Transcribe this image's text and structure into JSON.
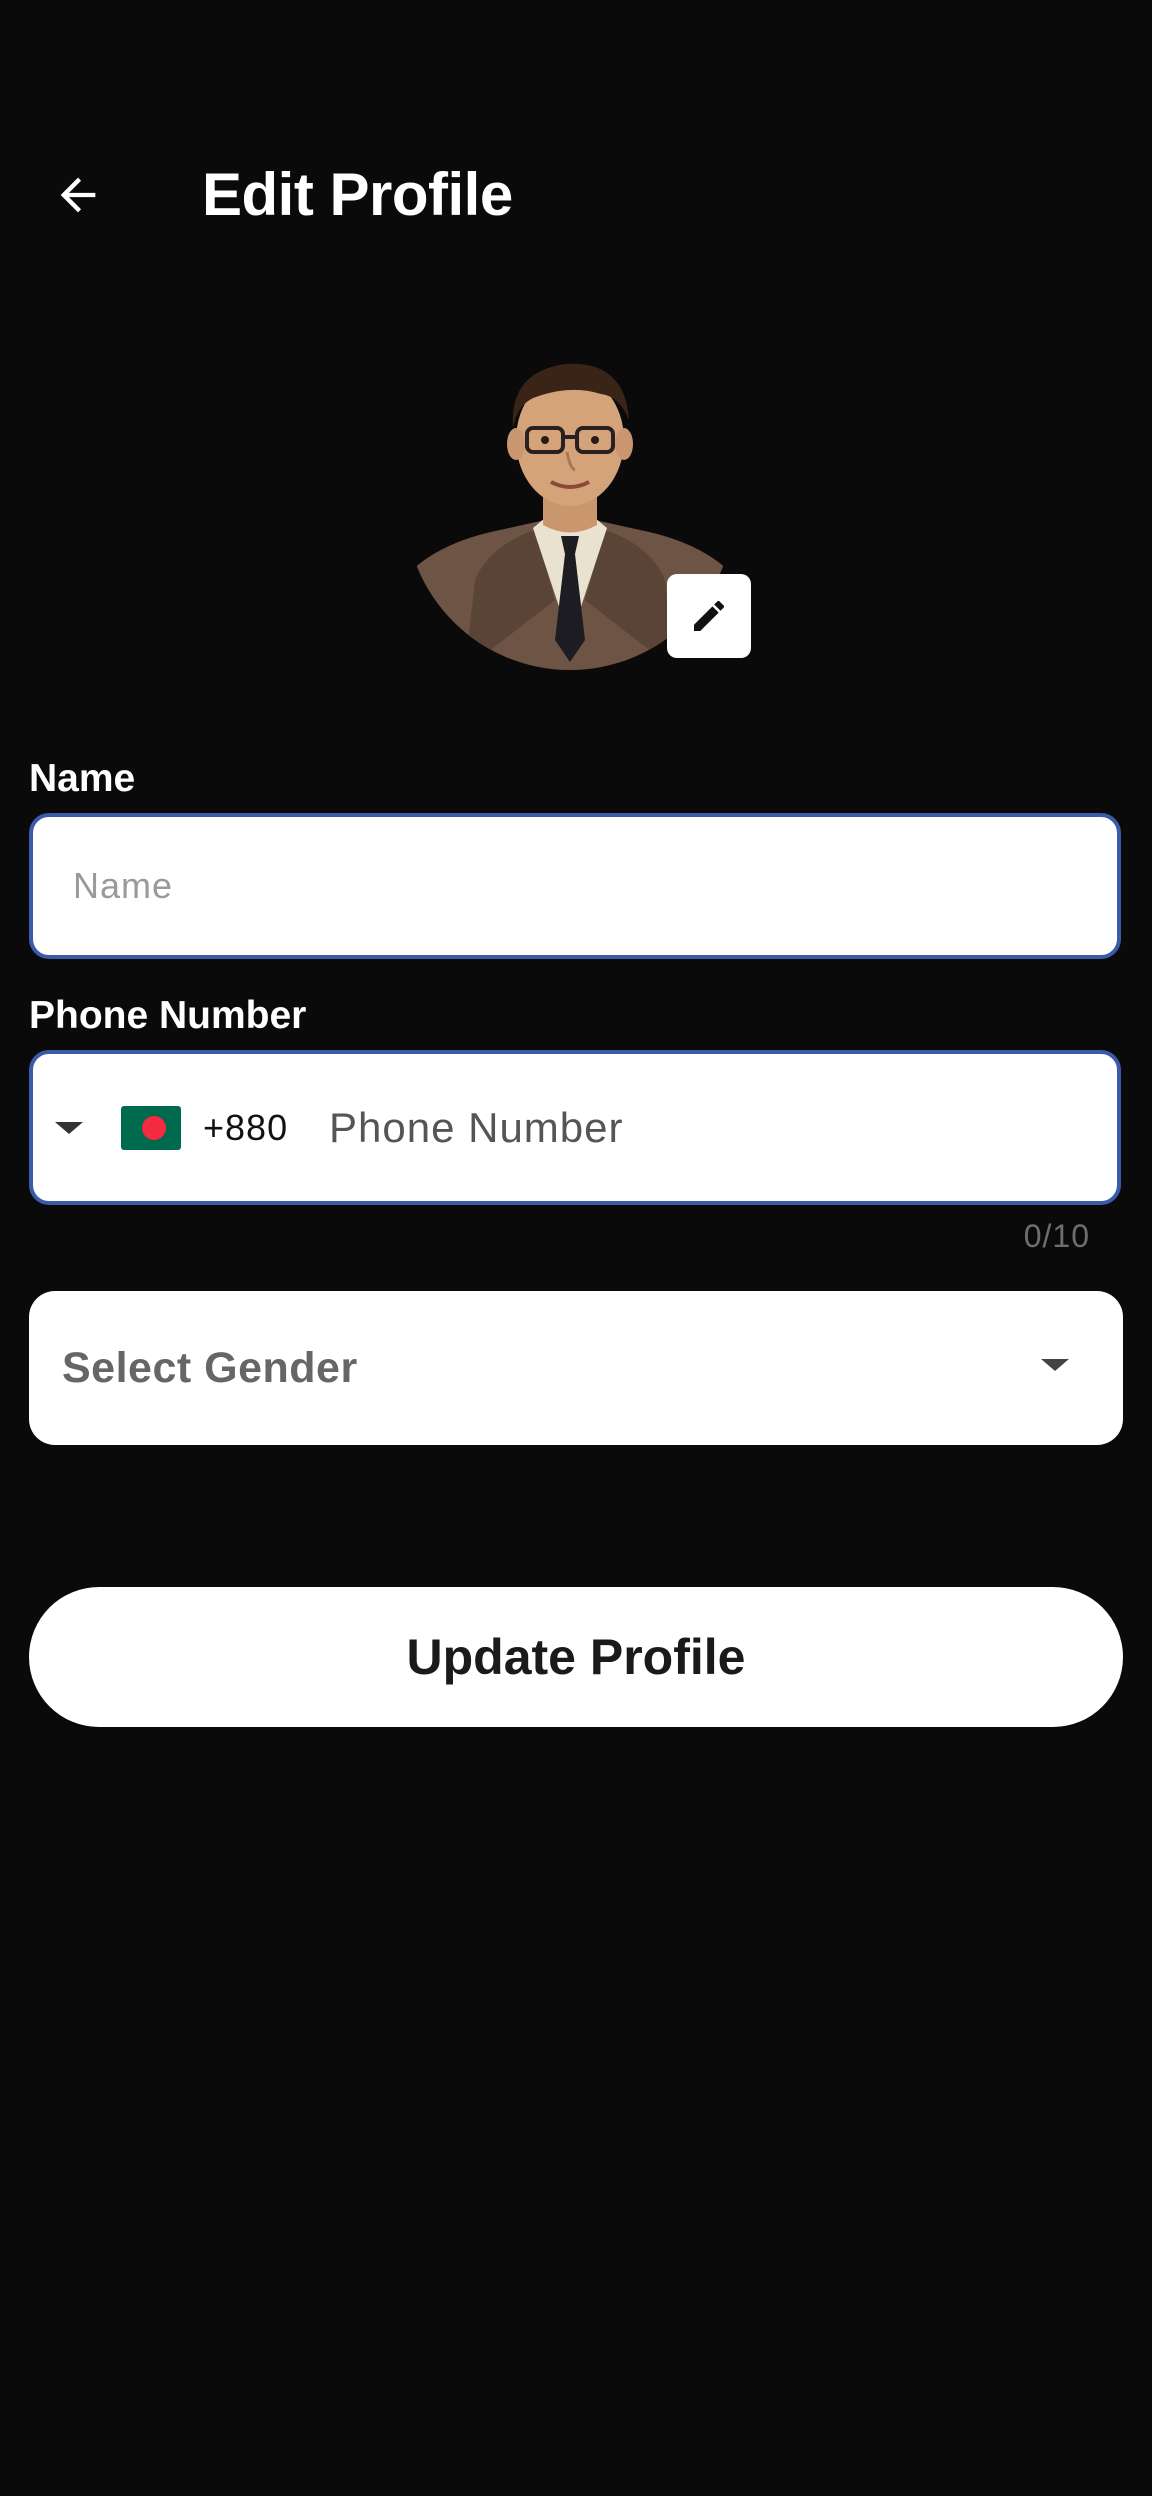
{
  "header": {
    "title": "Edit Profile",
    "back_icon": "arrow-left-icon"
  },
  "avatar": {
    "edit_icon": "pencil-icon"
  },
  "name_field": {
    "label": "Name",
    "value": "",
    "placeholder": "Name"
  },
  "phone_field": {
    "label": "Phone Number",
    "country_flag": "bangladesh-flag",
    "dial_code": "+880",
    "value": "",
    "placeholder": "Phone Number",
    "counter": "0/10"
  },
  "gender_select": {
    "placeholder": "Select Gender"
  },
  "actions": {
    "update_label": "Update Profile"
  },
  "colors": {
    "background": "#0a0a0a",
    "field_border": "#3a5ba8",
    "surface": "#ffffff"
  }
}
